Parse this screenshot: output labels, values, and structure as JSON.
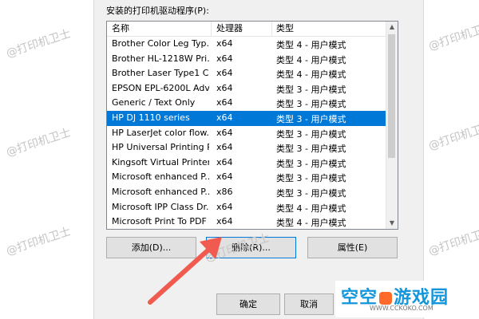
{
  "window": {
    "list_title": "安装的打印机驱动程序(P):"
  },
  "table": {
    "columns": [
      "名称",
      "处理器",
      "类型"
    ],
    "rows": [
      {
        "name": "Brother Color Leg Typ...",
        "proc": "x64",
        "type": "类型 4 - 用户模式"
      },
      {
        "name": "Brother HL-1218W Pri...",
        "proc": "x64",
        "type": "类型 4 - 用户模式"
      },
      {
        "name": "Brother Laser Type1 C...",
        "proc": "x64",
        "type": "类型 4 - 用户模式"
      },
      {
        "name": "EPSON EPL-6200L Adv...",
        "proc": "x64",
        "type": "类型 3 - 用户模式"
      },
      {
        "name": "Generic / Text Only",
        "proc": "x64",
        "type": "类型 3 - 用户模式"
      },
      {
        "name": "HP DJ 1110 series",
        "proc": "x64",
        "type": "类型 3 - 用户模式",
        "selected": true
      },
      {
        "name": "HP LaserJet color flow...",
        "proc": "x64",
        "type": "类型 3 - 用户模式"
      },
      {
        "name": "HP Universal Printing P...",
        "proc": "x64",
        "type": "类型 3 - 用户模式"
      },
      {
        "name": "Kingsoft Virtual Printer...",
        "proc": "x64",
        "type": "类型 3 - 用户模式"
      },
      {
        "name": "Microsoft enhanced P...",
        "proc": "x64",
        "type": "类型 3 - 用户模式"
      },
      {
        "name": "Microsoft enhanced P...",
        "proc": "x86",
        "type": "类型 3 - 用户模式"
      },
      {
        "name": "Microsoft IPP Class Dr...",
        "proc": "x64",
        "type": "类型 4 - 用户模式"
      },
      {
        "name": "Microsoft Print To PDF",
        "proc": "x64",
        "type": "类型 4 - 用户模式"
      }
    ]
  },
  "buttons": {
    "add": "添加(D)...",
    "remove": "删除(R)...",
    "properties": "属性(E)",
    "ok": "确定",
    "cancel": "取消"
  },
  "watermark": "@打印机卫士",
  "logo": {
    "title_a": "空空",
    "title_b": "游戏园",
    "url": "WWW.CCKOKO.COM"
  },
  "colors": {
    "selection": "#0078d7",
    "arrow": "#f05a4f",
    "logo": "#1296db"
  }
}
